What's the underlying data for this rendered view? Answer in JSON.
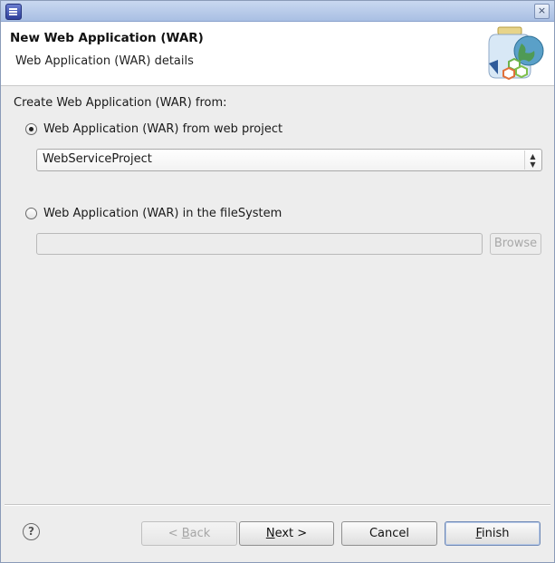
{
  "window": {
    "icon": "eclipse-app-icon",
    "close_glyph": "×"
  },
  "header": {
    "title": "New Web Application (WAR)",
    "description": "Web Application (WAR) details",
    "banner_icon": "war-wizard-banner-icon"
  },
  "form": {
    "section_label": "Create Web Application (WAR) from:",
    "option_project_label": "Web Application (WAR) from web project",
    "option_project_checked": true,
    "project_combo_value": "WebServiceProject",
    "option_filesystem_label": "Web Application (WAR) in the fileSystem",
    "option_filesystem_checked": false,
    "filesystem_path_value": "",
    "browse_label": "Browse"
  },
  "buttons": {
    "help_glyph": "?",
    "back_prefix": "< ",
    "back_mnemonic": "B",
    "back_rest": "ack",
    "next_mnemonic": "N",
    "next_rest": "ext >",
    "cancel_label": "Cancel",
    "finish_mnemonic": "F",
    "finish_rest": "inish"
  }
}
